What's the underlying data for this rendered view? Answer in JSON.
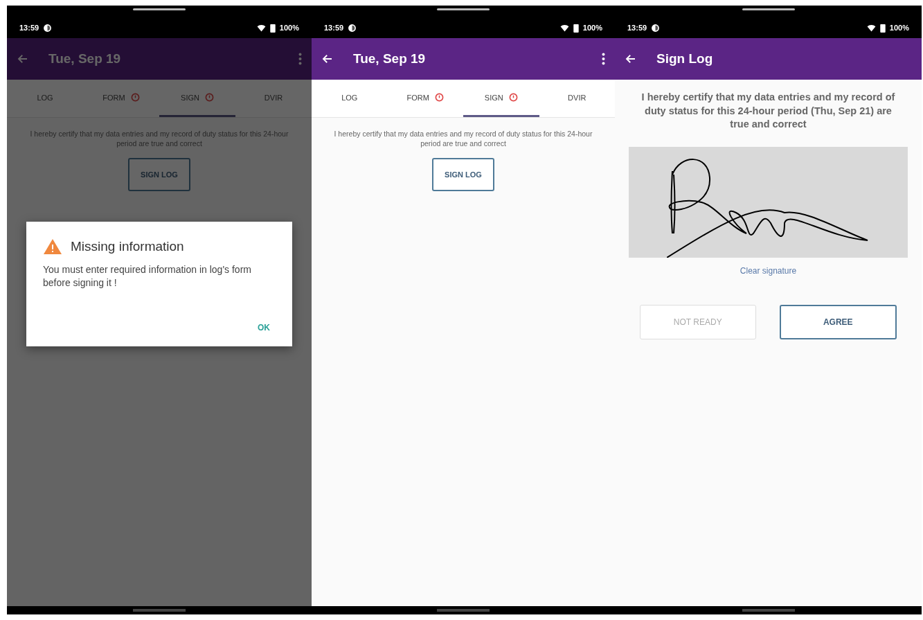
{
  "screens": [
    {
      "kind": "tabs",
      "status_bar": {
        "time": "13:59",
        "battery": "100%"
      },
      "app_bar": {
        "title": "Tue, Sep 19",
        "menu": true
      },
      "tabs": [
        {
          "label": "LOG",
          "selected": false,
          "alert": false
        },
        {
          "label": "FORM",
          "selected": false,
          "alert": true
        },
        {
          "label": "SIGN",
          "selected": true,
          "alert": true
        },
        {
          "label": "DVIR",
          "selected": false,
          "alert": false
        }
      ],
      "statement": "I hereby certify that my data entries and my record of duty status for this 24-hour period are true and correct",
      "sign_button": "SIGN LOG",
      "dialog": {
        "title": "Missing information",
        "message": "You must enter required information in log's form before signing it !",
        "button": "OK"
      }
    },
    {
      "kind": "tabs",
      "status_bar": {
        "time": "13:59",
        "battery": "100%"
      },
      "app_bar": {
        "title": "Tue, Sep 19",
        "menu": true
      },
      "tabs": [
        {
          "label": "LOG",
          "selected": false,
          "alert": false
        },
        {
          "label": "FORM",
          "selected": false,
          "alert": true
        },
        {
          "label": "SIGN",
          "selected": true,
          "alert": true
        },
        {
          "label": "DVIR",
          "selected": false,
          "alert": false
        }
      ],
      "statement": "I hereby certify that my data entries and my record of duty status for this 24-hour period are true and correct",
      "sign_button": "SIGN LOG"
    },
    {
      "kind": "sign",
      "status_bar": {
        "time": "13:59",
        "battery": "100%"
      },
      "app_bar": {
        "title": "Sign Log",
        "menu": false
      },
      "statement": "I hereby certify that my data entries and my record of duty status for this 24-hour period (Thu, Sep 21) are true and correct",
      "clear_link": "Clear signature",
      "buttons": [
        {
          "label": "NOT READY",
          "disabled": true
        },
        {
          "label": "AGREE",
          "disabled": false
        }
      ]
    }
  ]
}
